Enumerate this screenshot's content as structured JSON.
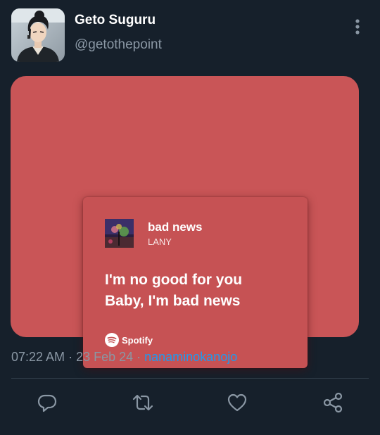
{
  "tweet": {
    "author": {
      "display_name": "Geto Suguru",
      "handle": "@getothepoint"
    },
    "media": {
      "song_title": "bad news",
      "artist": "LANY",
      "lyrics": [
        "I'm no good for you",
        "Baby, I'm bad news"
      ],
      "provider": "Spotify"
    },
    "time": "07:22 AM",
    "date": "23 Feb 24",
    "source": "nanaminokanojo",
    "separator": " · "
  },
  "actions": [
    "reply-icon",
    "retweet-icon",
    "like-icon",
    "share-icon"
  ],
  "colors": {
    "background": "#16202b",
    "card": "#c95557",
    "link": "#1d9bf0",
    "muted": "#8a97a4"
  }
}
